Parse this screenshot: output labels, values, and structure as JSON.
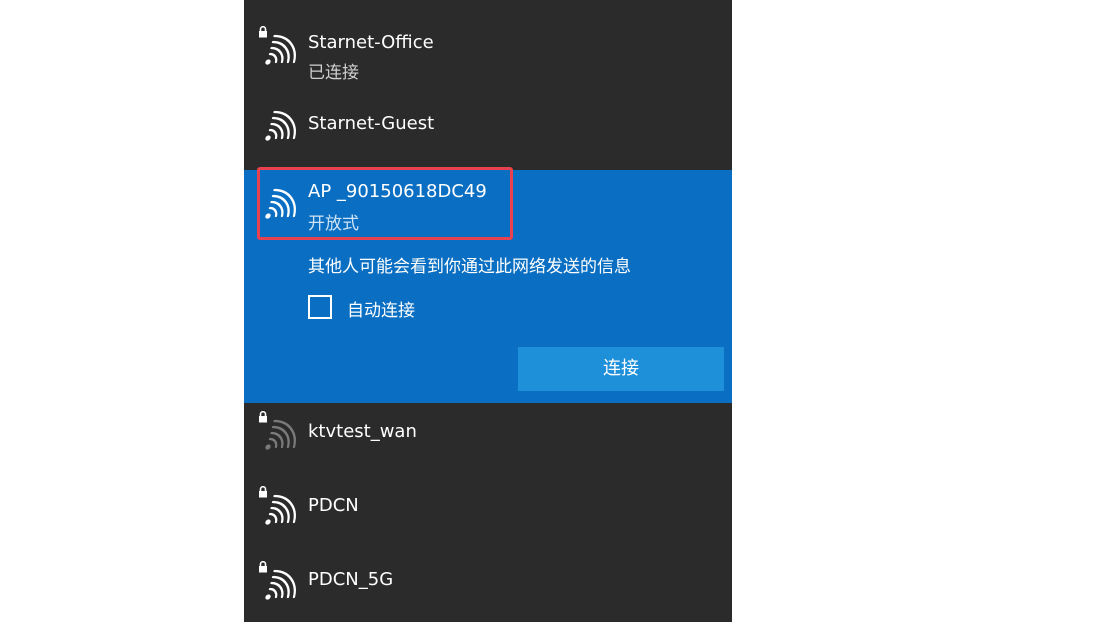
{
  "networks": [
    {
      "name": "Starnet-Office",
      "status": "已连接",
      "secured": true
    },
    {
      "name": "Starnet-Guest",
      "status": "",
      "secured": false
    },
    {
      "name": "AP _90150618DC49",
      "status": "开放式",
      "secured": false
    },
    {
      "name": "ktvtest_wan",
      "status": "",
      "secured": true
    },
    {
      "name": "PDCN",
      "status": "",
      "secured": true
    },
    {
      "name": "PDCN_5G",
      "status": "",
      "secured": true
    }
  ],
  "selected_network": {
    "warning": "其他人可能会看到你通过此网络发送的信息",
    "auto_connect_label": "自动连接",
    "auto_connect_checked": false,
    "connect_button_label": "连接"
  },
  "colors": {
    "panel_bg": "#2b2b2b",
    "selected_bg": "#0a6fc2",
    "button_bg": "#1e8fd9",
    "highlight_border": "#e8414f"
  },
  "icons": {
    "wifi": "wifi-signal-icon",
    "lock": "lock-icon",
    "checkbox": "checkbox-unchecked"
  }
}
